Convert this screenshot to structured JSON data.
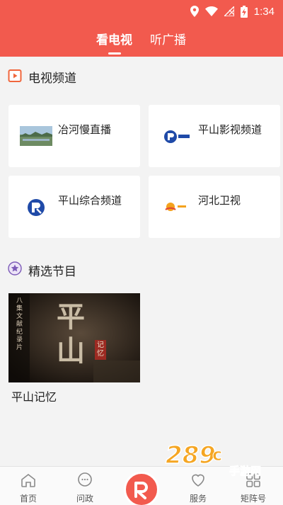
{
  "status_bar": {
    "time": "1:34"
  },
  "header": {
    "tabs": [
      {
        "label": "看电视",
        "active": true
      },
      {
        "label": "听广播",
        "active": false
      }
    ]
  },
  "tv_section": {
    "title": "电视频道",
    "channels": [
      {
        "label": "冶河慢直播"
      },
      {
        "label": "平山影视频道"
      },
      {
        "label": "平山综合频道"
      },
      {
        "label": "河北卫视"
      }
    ]
  },
  "featured_section": {
    "title": "精选节目",
    "programs": [
      {
        "title": "平山记忆",
        "poster_vertical_text": "八集文献纪录片",
        "poster_calligraphy": "平山",
        "poster_seal": "记忆"
      }
    ]
  },
  "bottom_nav": {
    "items": [
      {
        "label": "首页",
        "icon": "home-icon"
      },
      {
        "label": "问政",
        "icon": "chat-icon"
      },
      {
        "label": "服务",
        "icon": "heart-icon"
      },
      {
        "label": "矩阵号",
        "icon": "grid-icon"
      }
    ]
  },
  "watermark": {
    "text": "289",
    "sub": "手游网"
  },
  "colors": {
    "accent": "#f25a4e",
    "background": "#f3f3f3",
    "card": "#ffffff"
  }
}
